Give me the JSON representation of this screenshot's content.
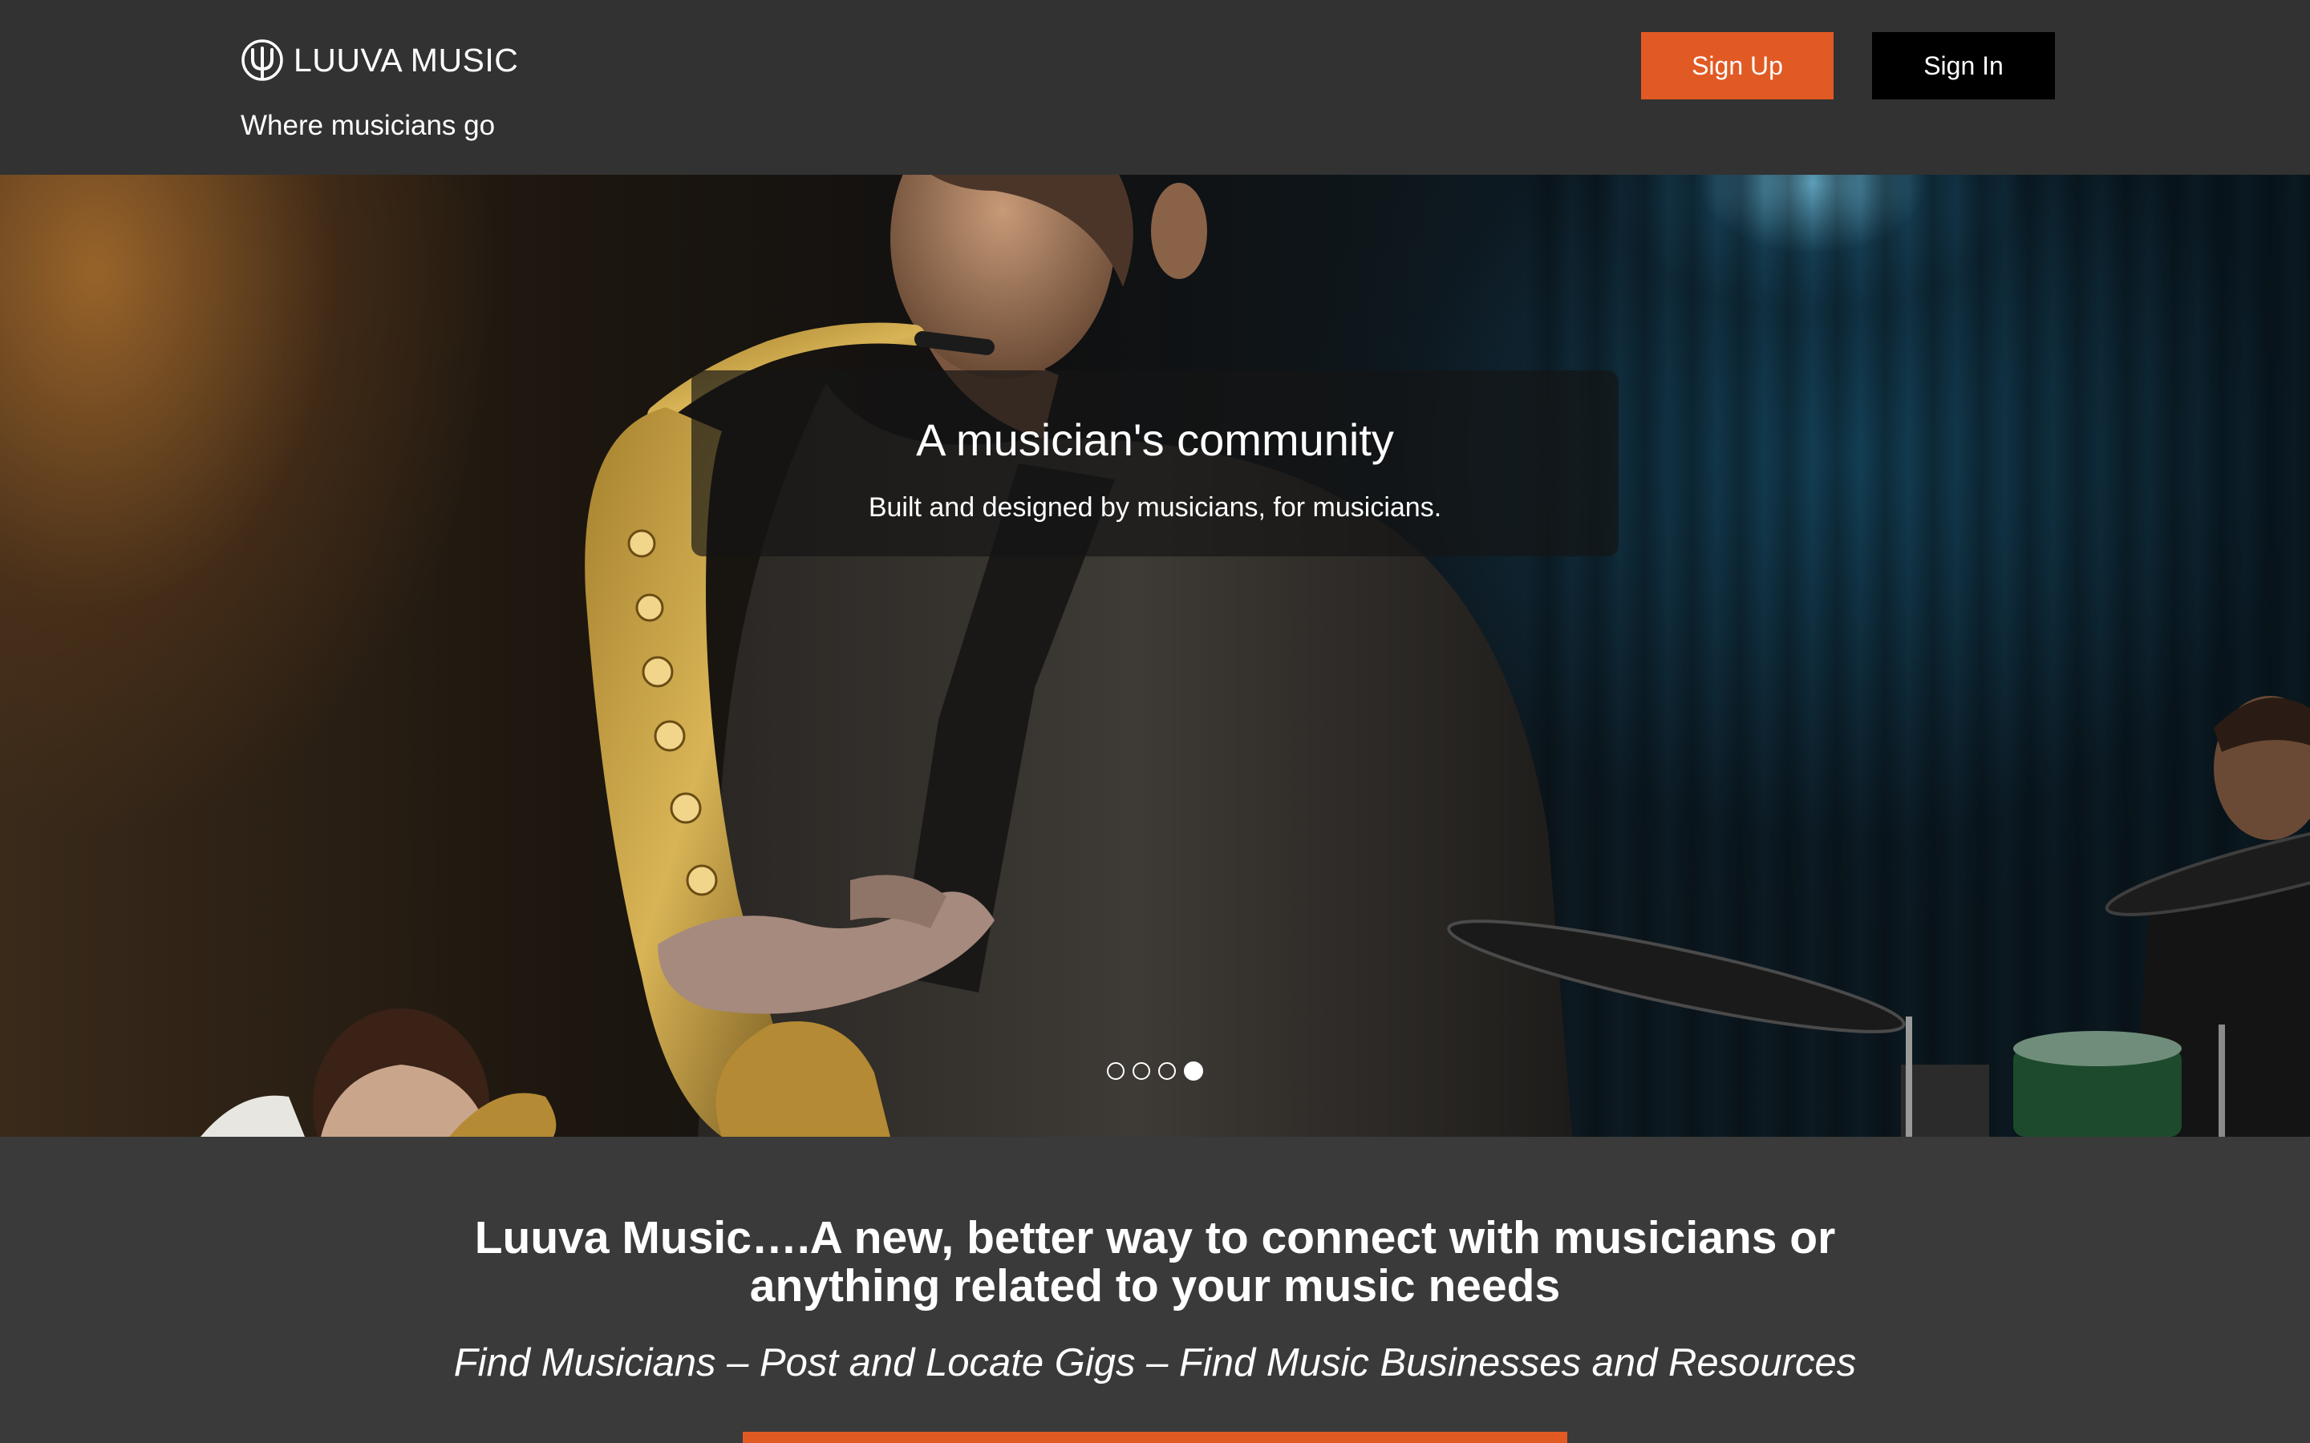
{
  "header": {
    "brand_name": "LUUVA MUSIC",
    "logo_icon": "psi-trident-icon",
    "tagline": "Where musicians go",
    "sign_up_label": "Sign Up",
    "sign_in_label": "Sign In"
  },
  "hero": {
    "caption_title": "A musician's community",
    "caption_subtitle": "Built and designed by musicians, for musicians.",
    "slides_total": 4,
    "active_slide": 4
  },
  "intro": {
    "heading_line1": "Luuva Music….A new, better way to connect with musicians or",
    "heading_line2": "anything related to your music needs",
    "tagline": "Find Musicians – Post and Locate Gigs – Find Music Businesses and Resources"
  },
  "colors": {
    "accent": "#e15a24",
    "header_bg": "#323232",
    "page_bg": "#3a3a3a",
    "sign_in_bg": "#000000"
  }
}
